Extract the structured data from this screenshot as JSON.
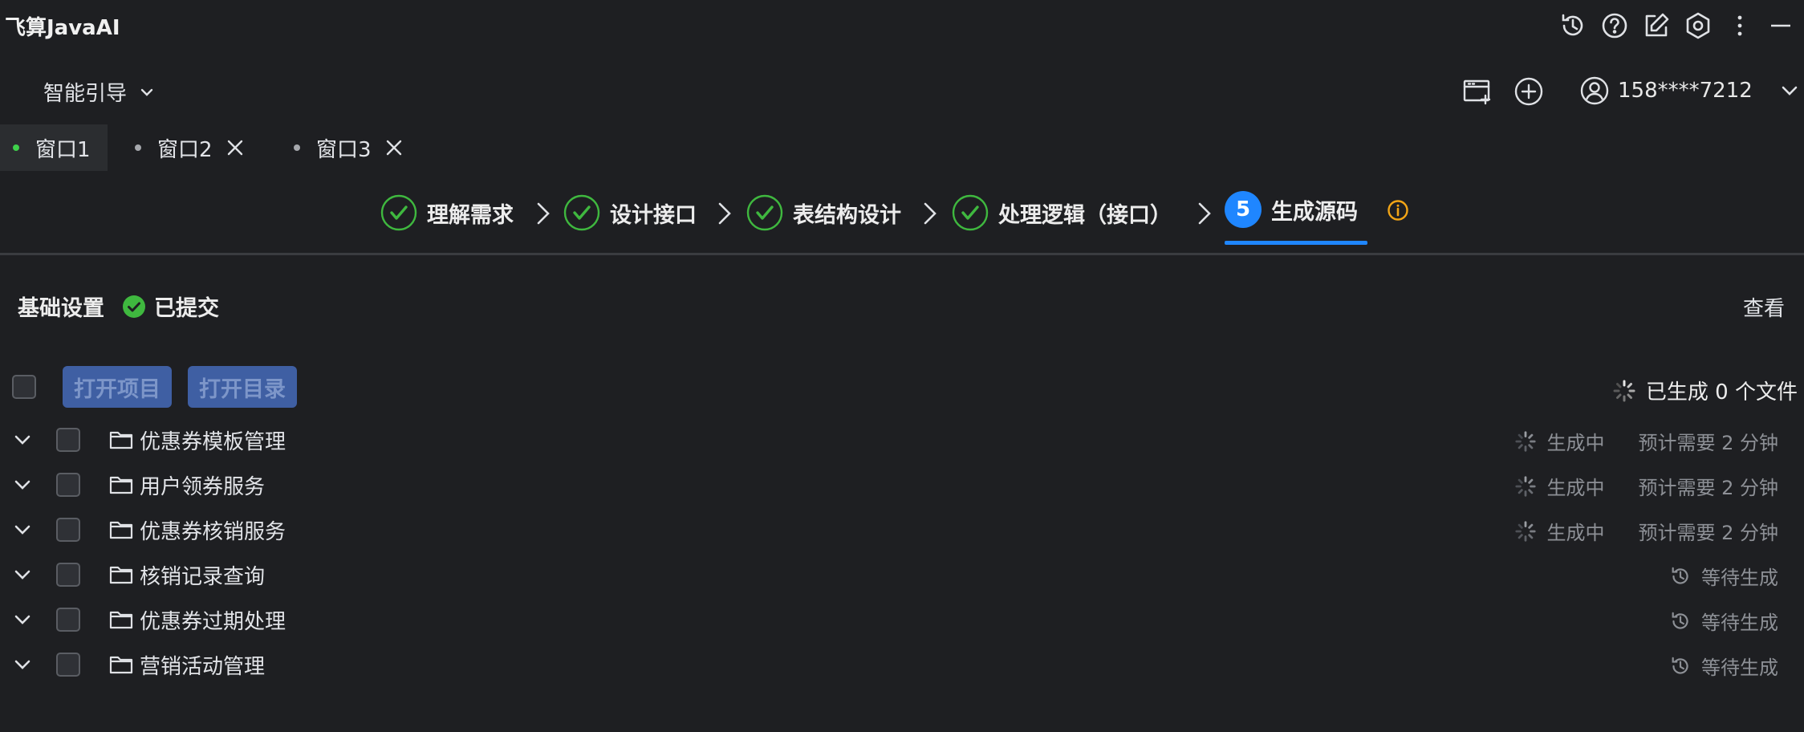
{
  "app": {
    "title": "飞算JavaAI"
  },
  "header": {
    "guide_label": "智能引导",
    "account_label": "158****7212",
    "icons": [
      "history-icon",
      "help-icon",
      "edit-icon",
      "settings-icon",
      "more-icon",
      "minimize-icon",
      "new-window-icon",
      "add-icon",
      "user-icon",
      "chevron-down-icon"
    ]
  },
  "windows": [
    {
      "label": "窗口1",
      "active": true
    },
    {
      "label": "窗口2",
      "active": false
    },
    {
      "label": "窗口3",
      "active": false
    }
  ],
  "steps": [
    {
      "label": "理解需求",
      "state": "done"
    },
    {
      "label": "设计接口",
      "state": "done"
    },
    {
      "label": "表结构设计",
      "state": "done"
    },
    {
      "label": "处理逻辑（接口）",
      "state": "done"
    },
    {
      "label": "生成源码",
      "state": "current",
      "number": "5"
    }
  ],
  "basic": {
    "title": "基础设置",
    "status": "已提交",
    "view_label": "查看"
  },
  "toolbar": {
    "open_project": "打开项目",
    "open_dir": "打开目录",
    "generated_count": "已生成 0 个文件"
  },
  "modules": [
    {
      "name": "优惠券模板管理",
      "status": "生成中",
      "eta": "预计需要 2 分钟",
      "state": "generating"
    },
    {
      "name": "用户领券服务",
      "status": "生成中",
      "eta": "预计需要 2 分钟",
      "state": "generating"
    },
    {
      "name": "优惠券核销服务",
      "status": "生成中",
      "eta": "预计需要 2 分钟",
      "state": "generating"
    },
    {
      "name": "核销记录查询",
      "status": "等待生成",
      "eta": "",
      "state": "waiting"
    },
    {
      "name": "优惠券过期处理",
      "status": "等待生成",
      "eta": "",
      "state": "waiting"
    },
    {
      "name": "营销活动管理",
      "status": "等待生成",
      "eta": "",
      "state": "waiting"
    }
  ],
  "colors": {
    "background": "#1e1f22",
    "accent": "#1f86ff",
    "success": "#3fb83f",
    "warning": "#f2a516",
    "button": "#3f5fa3"
  }
}
